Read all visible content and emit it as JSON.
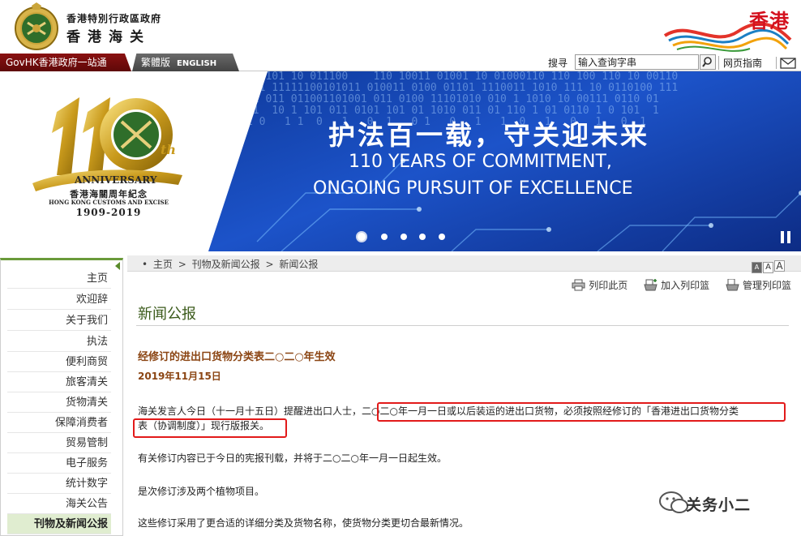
{
  "header": {
    "dept_name_full_cn": "香港特別行政區政府",
    "dept_name_cn": "香港海关",
    "brand_hk_text": "香港",
    "brand_colors": {
      "red": "#d4111e"
    }
  },
  "navbar": {
    "govhk_label": "GovHK香港政府一站通",
    "lang_trad": "繁體版",
    "lang_en": "ENGLISH",
    "search_label": "搜寻",
    "search_placeholder": "输入查询字串",
    "sitemap_label": "网页指南",
    "mail_icon": "mail-icon",
    "search_icon": "magnifier-icon"
  },
  "banner": {
    "anniv_number": "110",
    "anniv_th": "th",
    "anniv_word": "ANNIVERSARY",
    "anniv_cn": "香港海關周年紀念",
    "anniv_en": "HONG KONG CUSTOMS AND EXCISE",
    "anniv_years": "1909-2019",
    "title_cn": "护法百一载，守关迎未来",
    "title_en_1": "110 YEARS OF COMMITMENT,",
    "title_en_2": "ONGOING PURSUIT OF EXCELLENCE",
    "slide_count": 5,
    "active_slide": 1,
    "pause_icon": "pause-icon"
  },
  "sidebar": {
    "items": [
      {
        "label": "主页"
      },
      {
        "label": "欢迎辞"
      },
      {
        "label": "关于我们"
      },
      {
        "label": "执法"
      },
      {
        "label": "便利商贸"
      },
      {
        "label": "旅客清关"
      },
      {
        "label": "货物清关"
      },
      {
        "label": "保障消费者"
      },
      {
        "label": "贸易管制"
      },
      {
        "label": "电子服务"
      },
      {
        "label": "统计数字"
      },
      {
        "label": "海关公告"
      },
      {
        "label": "刊物及新闻公报",
        "active": true
      }
    ],
    "accent_color": "#6a9a3a"
  },
  "content": {
    "breadcrumb": [
      "主页",
      "刊物及新闻公报",
      "新闻公报"
    ],
    "breadcrumb_sep": ">",
    "breadcrumb_bullet": "•",
    "font_sizes": [
      "A",
      "A",
      "A"
    ],
    "tools": {
      "print": "列印此页",
      "add_basket": "加入列印篮",
      "manage_basket": "管理列印篮"
    },
    "page_heading": "新闻公报",
    "article_title": "经修订的进出口货物分类表二○二○年生效",
    "article_date": "2019年11月15日",
    "para1_a_plain": "海关发言人今日（十一月十五日）提醒进出口人士，",
    "para1_a_hl": "二○二○年一月一日或以后装运的进出口货物，必须按照经修订的「香港进出口货物分类",
    "para1_b_hl": "表（协调制度）」现行版报关。",
    "para2": "有关修订内容已于今日的宪报刊载，并将于二○二○年一月一日起生效。",
    "para3": "是次修订涉及两个植物项目。",
    "para4": "这些修订采用了更合适的详细分类及货物名称，使货物分类更切合最新情况。",
    "highlight_color": "#e21a1a"
  },
  "watermark": {
    "text": "关务小二",
    "icon": "wechat-icon"
  }
}
